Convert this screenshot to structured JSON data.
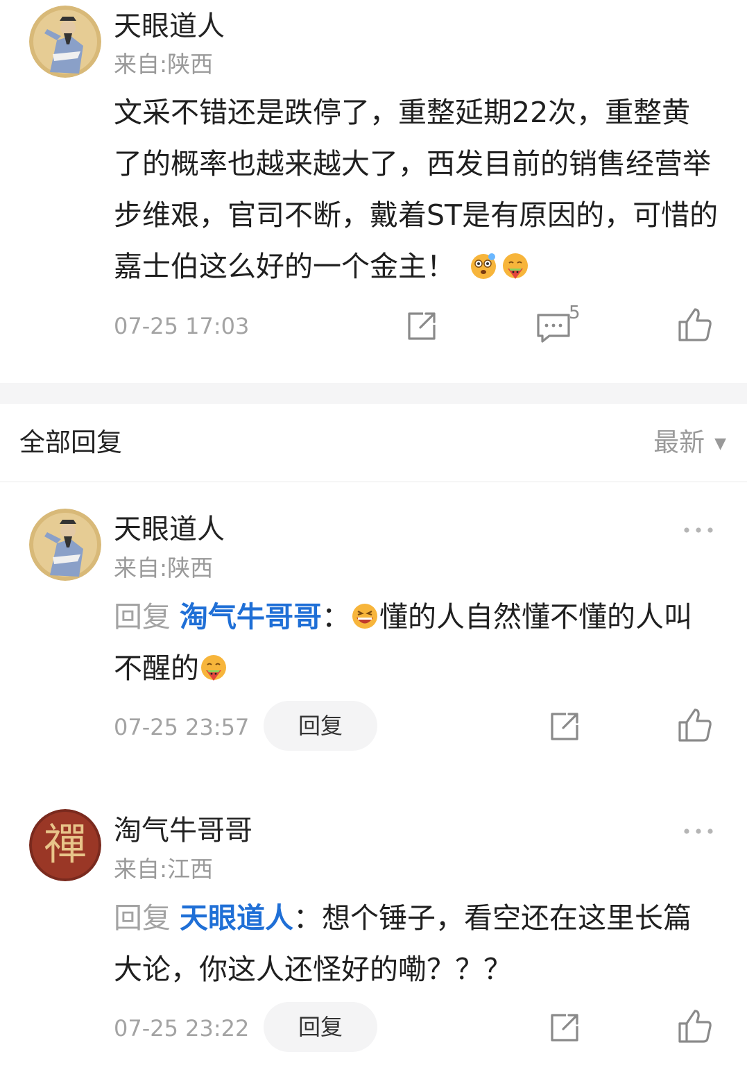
{
  "main_comment": {
    "username": "天眼道人",
    "location": "来自:陕西",
    "text": "文采不错还是跌停了，重整延期22次，重整黄了的概率也越来越大了，西发目前的销售经营举步维艰，官司不断，戴着ST是有原因的，可惜的嘉士伯这么好的一个金主！",
    "emojis": [
      "dizzy-face-emoji",
      "yum-face-emoji"
    ],
    "time": "07-25 17:03",
    "reply_count": "5"
  },
  "replies_header": {
    "title": "全部回复",
    "sort_label": "最新",
    "sort_caret": "▼"
  },
  "replies": [
    {
      "username": "天眼道人",
      "location": "来自:陕西",
      "reply_prefix": "回复",
      "mention": "淘气牛哥哥",
      "separator": "：",
      "text_a": "懂的人自然懂不懂的人叫不醒的",
      "time": "07-25 23:57",
      "reply_button": "回复"
    },
    {
      "username": "淘气牛哥哥",
      "location": "来自:江西",
      "reply_prefix": "回复",
      "mention": "天眼道人",
      "separator": "：",
      "text_a": "想个锤子，看空还在这里长篇大论，你这人还怪好的嘞？？？",
      "time": "07-25 23:22",
      "reply_button": "回复",
      "avatar_glyph": "禪"
    }
  ],
  "colors": {
    "accent_link": "#1f6fd6",
    "muted_text": "#a3a3a3",
    "divider": "#f5f5f6"
  }
}
